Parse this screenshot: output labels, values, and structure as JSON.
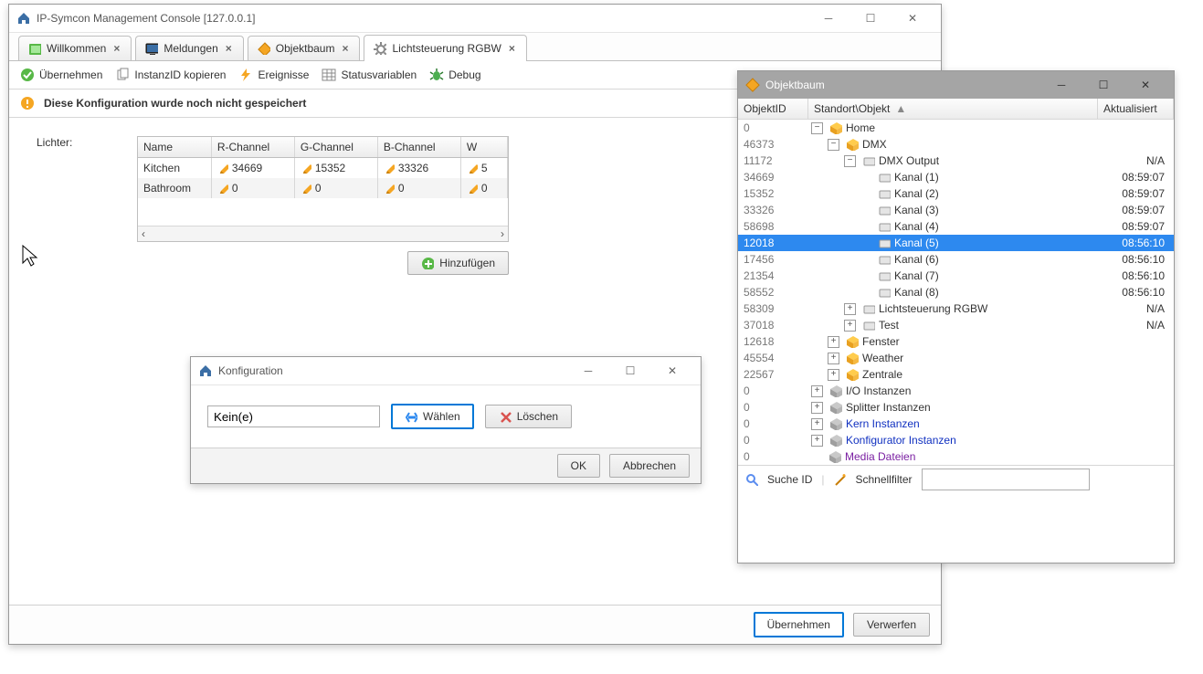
{
  "main_window": {
    "title": "IP-Symcon Management Console [127.0.0.1]",
    "tabs": [
      {
        "label": "Willkommen",
        "icon": "welcome"
      },
      {
        "label": "Meldungen",
        "icon": "monitor"
      },
      {
        "label": "Objektbaum",
        "icon": "cube"
      },
      {
        "label": "Lichtsteuerung RGBW",
        "icon": "gear",
        "active": true
      }
    ],
    "toolbar": {
      "apply": "Übernehmen",
      "copyid": "InstanzID kopieren",
      "events": "Ereignisse",
      "statusvars": "Statusvariablen",
      "debug": "Debug"
    },
    "warning": "Diese Konfiguration wurde noch nicht gespeichert",
    "lights_label": "Lichter:",
    "grid": {
      "columns": [
        "Name",
        "R-Channel",
        "G-Channel",
        "B-Channel",
        "W"
      ],
      "rows": [
        {
          "name": "Kitchen",
          "r": "34669",
          "g": "15352",
          "b": "33326",
          "w": "5"
        },
        {
          "name": "Bathroom",
          "r": "0",
          "g": "0",
          "b": "0",
          "w": "0"
        }
      ]
    },
    "add_button": "Hinzufügen",
    "footer": {
      "apply": "Übernehmen",
      "discard": "Verwerfen"
    }
  },
  "config_dialog": {
    "title": "Konfiguration",
    "value": "Kein(e)",
    "choose": "Wählen",
    "delete": "Löschen",
    "ok": "OK",
    "cancel": "Abbrechen"
  },
  "tree_window": {
    "title": "Objektbaum",
    "columns": {
      "id": "ObjektID",
      "path": "Standort\\Objekt",
      "updated": "Aktualisiert"
    },
    "rows": [
      {
        "id": "0",
        "depth": 0,
        "exp": "-",
        "icon": "cube-y",
        "label": "Home",
        "time": ""
      },
      {
        "id": "46373",
        "depth": 1,
        "exp": "-",
        "icon": "cube-y",
        "label": "DMX",
        "time": ""
      },
      {
        "id": "11172",
        "depth": 2,
        "exp": "-",
        "icon": "device",
        "label": "DMX Output",
        "time": "N/A"
      },
      {
        "id": "34669",
        "depth": 3,
        "exp": "",
        "icon": "device",
        "label": "Kanal (1)",
        "time": "08:59:07"
      },
      {
        "id": "15352",
        "depth": 3,
        "exp": "",
        "icon": "device",
        "label": "Kanal (2)",
        "time": "08:59:07"
      },
      {
        "id": "33326",
        "depth": 3,
        "exp": "",
        "icon": "device",
        "label": "Kanal (3)",
        "time": "08:59:07"
      },
      {
        "id": "58698",
        "depth": 3,
        "exp": "",
        "icon": "device",
        "label": "Kanal (4)",
        "time": "08:59:07"
      },
      {
        "id": "12018",
        "depth": 3,
        "exp": "",
        "icon": "device",
        "label": "Kanal (5)",
        "time": "08:56:10",
        "selected": true
      },
      {
        "id": "17456",
        "depth": 3,
        "exp": "",
        "icon": "device",
        "label": "Kanal (6)",
        "time": "08:56:10"
      },
      {
        "id": "21354",
        "depth": 3,
        "exp": "",
        "icon": "device",
        "label": "Kanal (7)",
        "time": "08:56:10"
      },
      {
        "id": "58552",
        "depth": 3,
        "exp": "",
        "icon": "device",
        "label": "Kanal (8)",
        "time": "08:56:10"
      },
      {
        "id": "58309",
        "depth": 2,
        "exp": "+",
        "icon": "device",
        "label": "Lichtsteuerung RGBW",
        "time": "N/A"
      },
      {
        "id": "37018",
        "depth": 2,
        "exp": "+",
        "icon": "device",
        "label": "Test",
        "time": "N/A"
      },
      {
        "id": "12618",
        "depth": 1,
        "exp": "+",
        "icon": "cube-y",
        "label": "Fenster",
        "time": ""
      },
      {
        "id": "45554",
        "depth": 1,
        "exp": "+",
        "icon": "cube-y",
        "label": "Weather",
        "time": ""
      },
      {
        "id": "22567",
        "depth": 1,
        "exp": "+",
        "icon": "cube-y",
        "label": "Zentrale",
        "time": ""
      },
      {
        "id": "0",
        "depth": 0,
        "exp": "+",
        "icon": "cube-g",
        "label": "I/O Instanzen",
        "time": ""
      },
      {
        "id": "0",
        "depth": 0,
        "exp": "+",
        "icon": "cube-g",
        "label": "Splitter Instanzen",
        "time": ""
      },
      {
        "id": "0",
        "depth": 0,
        "exp": "+",
        "icon": "cube-g",
        "label": "Kern Instanzen",
        "time": "",
        "cls": "link-blue"
      },
      {
        "id": "0",
        "depth": 0,
        "exp": "+",
        "icon": "cube-g",
        "label": "Konfigurator Instanzen",
        "time": "",
        "cls": "link-blue"
      },
      {
        "id": "0",
        "depth": 0,
        "exp": "",
        "icon": "cube-g",
        "label": "Media Dateien",
        "time": "",
        "cls": "link-purple"
      }
    ],
    "footer": {
      "search": "Suche ID",
      "filter": "Schnellfilter"
    }
  }
}
